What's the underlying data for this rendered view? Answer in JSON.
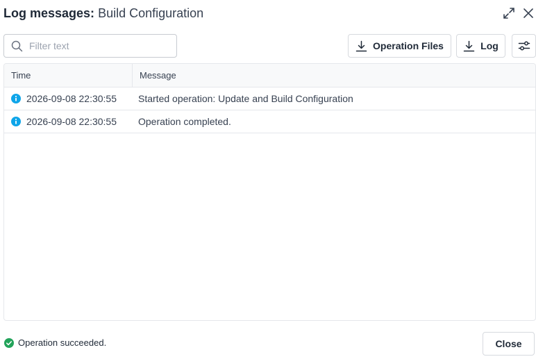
{
  "dialog": {
    "title_prefix": "Log messages:",
    "title_subject": "Build Configuration",
    "icons": {
      "expand": "expand-icon",
      "close": "close-icon"
    }
  },
  "toolbar": {
    "search_placeholder": "Filter text",
    "search_value": "",
    "operation_files_label": "Operation Files",
    "log_label": "Log",
    "icons": {
      "search": "search-icon",
      "download": "download-icon",
      "settings": "sliders-icon"
    }
  },
  "table": {
    "columns": [
      "Time",
      "Message"
    ],
    "rows": [
      {
        "level": "info",
        "time": "2026-09-08 22:30:55",
        "message": "Started operation: Update and Build Configuration"
      },
      {
        "level": "info",
        "time": "2026-09-08 22:30:55",
        "message": "Operation completed."
      }
    ]
  },
  "footer": {
    "status_text": "Operation succeeded.",
    "close_label": "Close"
  },
  "colors": {
    "info": "#0ea5e9",
    "success": "#22a35a",
    "text": "#1f2937"
  }
}
